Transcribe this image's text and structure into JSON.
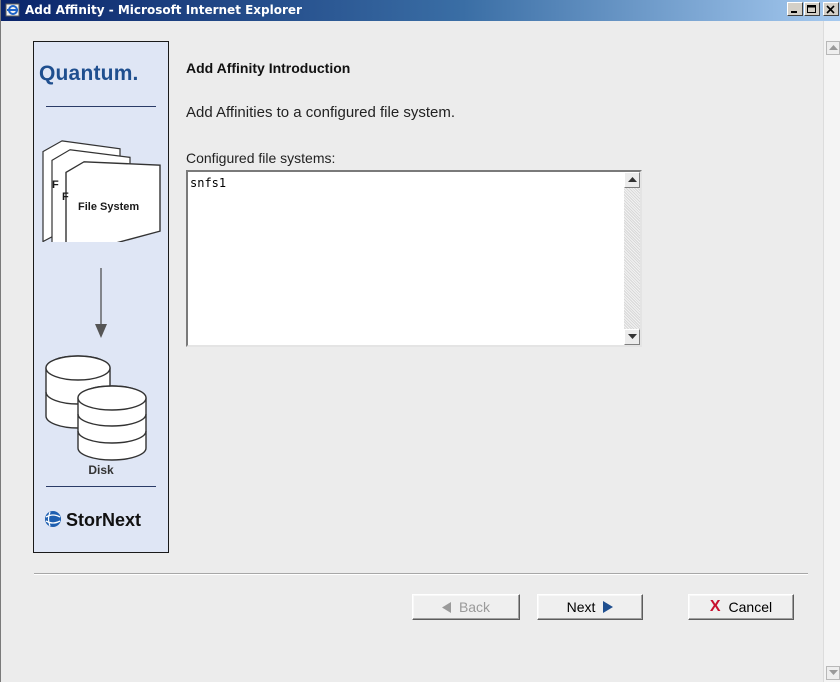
{
  "window": {
    "title": "Add Affinity - Microsoft Internet Explorer",
    "controls": [
      "minimize",
      "maximize",
      "close"
    ]
  },
  "sidebar": {
    "brand": "Quantum.",
    "illustration_label": "File System",
    "illustration_label_partial": "F",
    "disk_label": "Disk",
    "product": "StorNext"
  },
  "main": {
    "heading": "Add Affinity Introduction",
    "intro": "Add Affinities to a configured file system.",
    "list_label": "Configured file systems:",
    "file_systems": [
      "snfs1"
    ]
  },
  "buttons": {
    "back": "Back",
    "next": "Next",
    "cancel": "Cancel",
    "back_enabled": false
  },
  "colors": {
    "brand_blue": "#1f4f8f",
    "cancel_x": "#c8102e",
    "arrow_blue": "#1f4f8f",
    "sidebar_bg": "#dfe6f5"
  }
}
